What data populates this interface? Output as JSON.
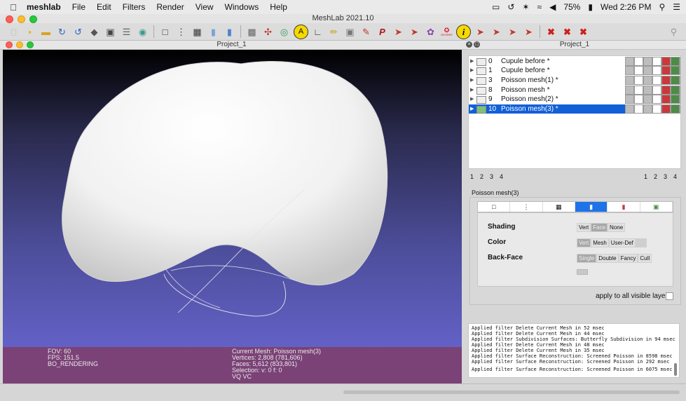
{
  "menubar": {
    "app_name": "meshlab",
    "menus": [
      "File",
      "Edit",
      "Filters",
      "Render",
      "View",
      "Windows",
      "Help"
    ],
    "battery": "75%",
    "clock": "Wed 2:26 PM"
  },
  "window": {
    "title": "MeshLab 2021.10"
  },
  "toolbar": {
    "icons": [
      "new-file-icon",
      "open-folder-icon",
      "open-project-icon",
      "reload-icon",
      "reload-all-icon",
      "save-icon",
      "snapshot-icon",
      "layers-icon",
      "color-wheel-icon",
      "bbox-icon",
      "points-icon",
      "wireframe-icon",
      "flat-icon",
      "smooth-icon",
      "textured-icon",
      "trackball-icon",
      "axis-icon",
      "sphere-icon",
      "annotate-icon",
      "measure-icon",
      "paint-icon",
      "select-faces-icon",
      "select-vertices-icon",
      "select-connected-icon",
      "georef-icon",
      "info-icon",
      "pick-points-icon",
      "align-icon",
      "move-icon",
      "transform-icon",
      "delete-faces-icon",
      "delete-vertices-icon",
      "delete-selection-icon",
      "search-icon"
    ],
    "letter_a": "A",
    "letter_p": "P",
    "letter_i": "i",
    "georef_label": "GEOREF"
  },
  "viewport": {
    "title": "Project_1",
    "info": {
      "fov": "FOV: 60",
      "fps": "FPS:  151.5",
      "mode": "BO_RENDERING",
      "current_mesh": "Current Mesh: Poisson mesh(3)",
      "vertices": "Vertices: 2,808    (781,606)",
      "faces": "Faces: 5,612    (833,801)",
      "selection": "Selection: v: 0 f: 0",
      "attrs": "VQ VC"
    }
  },
  "side": {
    "title": "Project_1",
    "layers": [
      {
        "id": "0",
        "name": "Cupule before *"
      },
      {
        "id": "1",
        "name": "Cupule before *"
      },
      {
        "id": "3",
        "name": "Poisson mesh(1) *"
      },
      {
        "id": "8",
        "name": "Poisson mesh *"
      },
      {
        "id": "9",
        "name": "Poisson mesh(2) *"
      },
      {
        "id": "10",
        "name": "Poisson mesh(3) *"
      }
    ],
    "pages_left": [
      "1",
      "2",
      "3",
      "4"
    ],
    "pages_right": [
      "1",
      "2",
      "3",
      "4"
    ],
    "mesh_label": "Poisson mesh(3)",
    "render": {
      "shading_label": "Shading",
      "shading_opts": [
        "Vert",
        "Face",
        "None"
      ],
      "color_label": "Color",
      "color_opts": [
        "Vert",
        "Mesh",
        "User-Def"
      ],
      "backface_label": "Back-Face",
      "backface_opts": [
        "Single",
        "Double",
        "Fancy",
        "Cull"
      ]
    },
    "apply_label": "apply to all visible layers",
    "log": [
      "Applied filter Delete Current Mesh in 52 msec",
      "Applied filter Delete Current Mesh in 44 msec",
      "Applied filter Subdivision Surfaces: Butterfly Subdivision in 94 msec",
      "Applied filter Delete Current Mesh in 48 msec",
      "Applied filter Delete Current Mesh in 35 msec",
      "Applied filter Surface Reconstruction: Screened Poisson in 8598 msec",
      "Applied filter Surface Reconstruction: Screened Poisson in 292 msec",
      "",
      "Applied filter Surface Reconstruction: Screened Poisson in 6075 msec"
    ]
  }
}
